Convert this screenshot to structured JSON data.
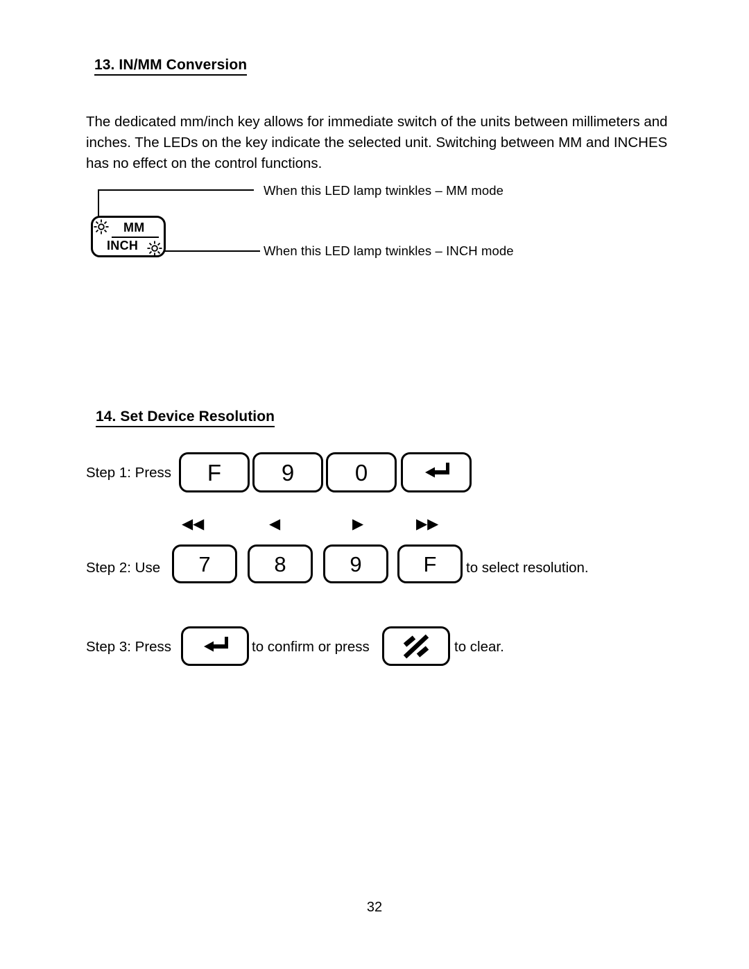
{
  "page": {
    "number": "32",
    "background_color": "#ffffff",
    "text_color": "#000000"
  },
  "sections": [
    {
      "id": "in-mm-conversion",
      "heading": "13. IN/MM Conversion",
      "paragraph": "The dedicated mm/inch key allows for immediate switch of the units between millimeters and inches. The LEDs on the key indicate the selected unit. Switching between MM and INCHES has no effect on the control functions.",
      "diagram": {
        "key": {
          "top_label": "MM",
          "bottom_label": "INCH",
          "led_top_left_icon": "led-lamp-icon",
          "led_bottom_right_icon": "led-lamp-icon"
        },
        "callouts": [
          {
            "icon": "led-lamp-icon",
            "text": "When this LED lamp twinkles – MM mode"
          },
          {
            "icon": "led-lamp-icon",
            "text": "When this LED lamp twinkles – INCH mode"
          }
        ]
      }
    },
    {
      "id": "set-device-resolution",
      "heading": "14. Set Device Resolution",
      "steps": [
        {
          "label": "Step 1: Press",
          "keys": [
            {
              "name": "key-f",
              "glyph": "F",
              "type": "text"
            },
            {
              "name": "key-9",
              "glyph": "9",
              "type": "text"
            },
            {
              "name": "key-0",
              "glyph": "0",
              "type": "text"
            },
            {
              "name": "key-enter",
              "glyph": "↵",
              "type": "icon",
              "icon": "enter-arrow-icon"
            }
          ],
          "trailing": ""
        },
        {
          "label": "Step 2: Use",
          "keys": [
            {
              "name": "key-7",
              "glyph": "7",
              "type": "text",
              "arrows": "◀◀",
              "arrow_name": "double-left-arrow-icon"
            },
            {
              "name": "key-8",
              "glyph": "8",
              "type": "text",
              "arrows": "◀",
              "arrow_name": "left-arrow-icon"
            },
            {
              "name": "key-9",
              "glyph": "9",
              "type": "text",
              "arrows": "▶",
              "arrow_name": "right-arrow-icon"
            },
            {
              "name": "key-f",
              "glyph": "F",
              "type": "text",
              "arrows": "▶▶",
              "arrow_name": "double-right-arrow-icon"
            }
          ],
          "trailing": "to select resolution."
        },
        {
          "label": "Step 3: Press",
          "keys": [
            {
              "name": "key-enter",
              "glyph": "↵",
              "type": "icon",
              "icon": "enter-arrow-icon"
            },
            {
              "name": "key-clear",
              "glyph": "",
              "type": "icon",
              "icon": "clear-slash-icon"
            }
          ],
          "middle_text": "to confirm or press",
          "trailing": "to clear."
        }
      ]
    }
  ]
}
